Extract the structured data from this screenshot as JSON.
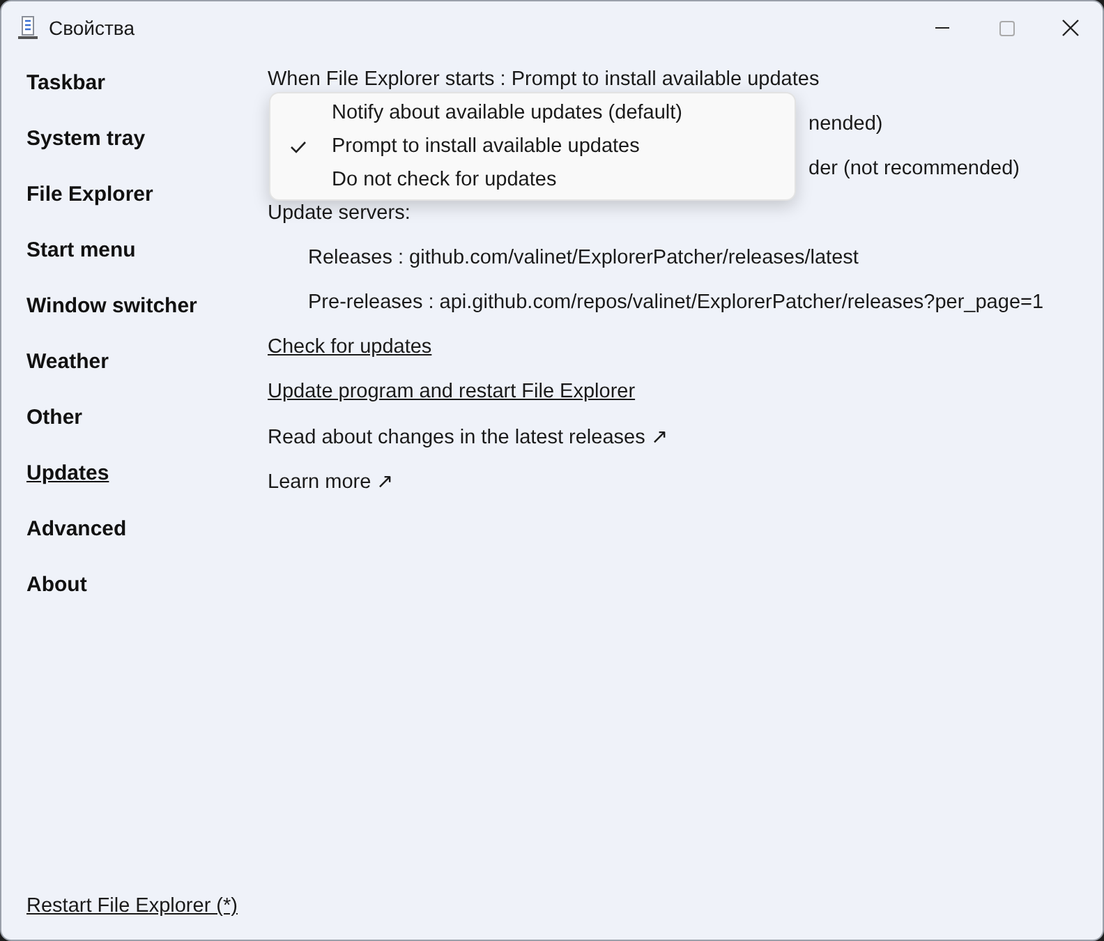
{
  "window": {
    "title": "Свойства"
  },
  "sidebar": {
    "items": [
      {
        "label": "Taskbar",
        "selected": false
      },
      {
        "label": "System tray",
        "selected": false
      },
      {
        "label": "File Explorer",
        "selected": false
      },
      {
        "label": "Start menu",
        "selected": false
      },
      {
        "label": "Window switcher",
        "selected": false
      },
      {
        "label": "Weather",
        "selected": false
      },
      {
        "label": "Other",
        "selected": false
      },
      {
        "label": "Updates",
        "selected": true
      },
      {
        "label": "Advanced",
        "selected": false
      },
      {
        "label": "About",
        "selected": false
      }
    ],
    "restart_link": "Restart File Explorer (*)"
  },
  "content": {
    "setting": "When File Explorer starts : Prompt to install available updates",
    "obscured_rows": [
      "nended)",
      "der (not recommended)"
    ],
    "servers_heading": "Update servers:",
    "servers": [
      "Releases : github.com/valinet/ExplorerPatcher/releases/latest",
      "Pre-releases : api.github.com/repos/valinet/ExplorerPatcher/releases?per_page=1"
    ],
    "links": [
      {
        "label": "Check for updates",
        "kind": "link"
      },
      {
        "label": "Update program and restart File Explorer",
        "kind": "link"
      },
      {
        "label": "Read about changes in the latest releases ↗",
        "kind": "external"
      },
      {
        "label": "Learn more ↗",
        "kind": "external"
      }
    ]
  },
  "dropdown_menu": {
    "items": [
      {
        "label": "Notify about available updates (default)",
        "selected": false
      },
      {
        "label": "Prompt to install available updates",
        "selected": true
      },
      {
        "label": "Do not check for updates",
        "selected": false
      }
    ]
  }
}
